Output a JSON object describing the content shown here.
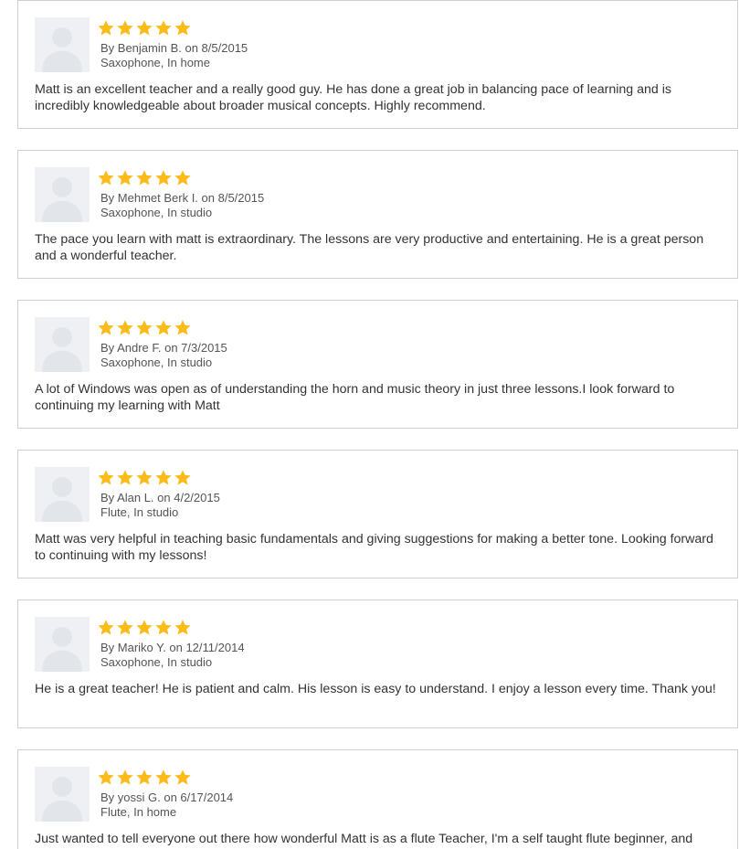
{
  "star_color": "#fbbc1b",
  "avatar_icon": "user-silhouette-icon",
  "star_icon": "star-icon",
  "reviews": [
    {
      "rating": 5,
      "byline": "By Benjamin B. on 8/5/2015",
      "subject": "Saxophone, In home",
      "text": "Matt is an excellent teacher and a really good guy. He has done a great job in balancing pace of learning and is incredibly knowledgeable about broader musical concepts. Highly recommend."
    },
    {
      "rating": 5,
      "byline": "By Mehmet Berk I. on 8/5/2015",
      "subject": "Saxophone, In studio",
      "text": "The pace you learn with matt is extraordinary. The lessons are very productive and entertaining. He is a great person and a wonderful teacher."
    },
    {
      "rating": 5,
      "byline": "By Andre F. on 7/3/2015",
      "subject": "Saxophone, In studio",
      "text": "A lot of Windows was open as of understanding the horn and music theory in just three lessons.I look forward to continuing my learning with Matt"
    },
    {
      "rating": 5,
      "byline": "By Alan L. on 4/2/2015",
      "subject": "Flute, In studio",
      "text": "Matt was very helpful in teaching basic fundamentals and giving suggestions for making a better tone. Looking forward to continuing with my lessons!"
    },
    {
      "rating": 5,
      "byline": "By Mariko Y. on 12/11/2014",
      "subject": "Saxophone, In studio",
      "text": "He is a great teacher! He is patient and calm. His lesson is easy to understand. I enjoy a lesson every time. Thank you!"
    },
    {
      "rating": 5,
      "byline": "By yossi G. on 6/17/2014",
      "subject": "Flute, In home",
      "text": "Just wanted to tell everyone out there how wonderful Matt is as a flute Teacher, I'm a self taught flute beginner, and"
    }
  ]
}
